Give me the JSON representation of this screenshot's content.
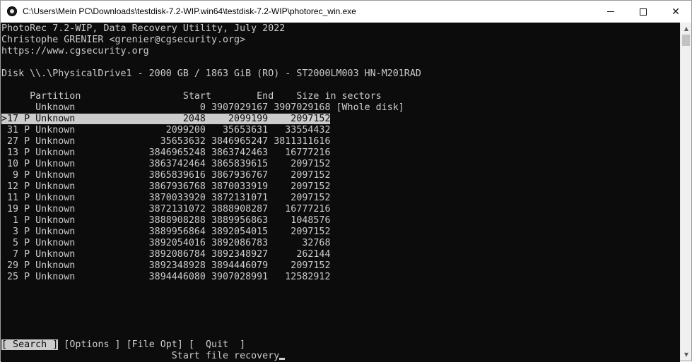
{
  "window": {
    "title": "C:\\Users\\Mein PC\\Downloads\\testdisk-7.2-WIP.win64\\testdisk-7.2-WIP\\photorec_win.exe",
    "controls": {
      "minimize": "minimize",
      "maximize": "maximize",
      "close": "✕"
    }
  },
  "header": {
    "line1": "PhotoRec 7.2-WIP, Data Recovery Utility, July 2022",
    "line2": "Christophe GRENIER <grenier@cgsecurity.org>",
    "line3": "https://www.cgsecurity.org"
  },
  "disk": {
    "info": "Disk \\\\.\\PhysicalDrive1 - 2000 GB / 1863 GiB (RO) - ST2000LM003 HN-M201RAD"
  },
  "table": {
    "header": "     Partition                  Start        End    Size in sectors",
    "rows": [
      "      Unknown                      0 3907029167 3907029168 [Whole disk]",
      ">17 P Unknown                   2048    2099199    2097152",
      " 31 P Unknown                2099200   35653631   33554432",
      " 27 P Unknown               35653632 3846965247 3811311616",
      " 13 P Unknown             3846965248 3863742463   16777216",
      " 10 P Unknown             3863742464 3865839615    2097152",
      "  9 P Unknown             3865839616 3867936767    2097152",
      " 12 P Unknown             3867936768 3870033919    2097152",
      " 11 P Unknown             3870033920 3872131071    2097152",
      " 19 P Unknown             3872131072 3888908287   16777216",
      "  1 P Unknown             3888908288 3889956863    1048576",
      "  3 P Unknown             3889956864 3892054015    2097152",
      "  5 P Unknown             3892054016 3892086783      32768",
      "  7 P Unknown             3892086784 3892348927     262144",
      " 29 P Unknown             3892348928 3894446079    2097152",
      " 25 P Unknown             3894446080 3907028991   12582912"
    ],
    "selected_index": 1
  },
  "menu": {
    "search": "[ Search ]",
    "gap1": " ",
    "options": "[Options ]",
    "gap2": " ",
    "file_opt": "[File Opt]",
    "gap3": " ",
    "quit": "[  Quit  ]",
    "hint": "                              Start file recovery"
  }
}
